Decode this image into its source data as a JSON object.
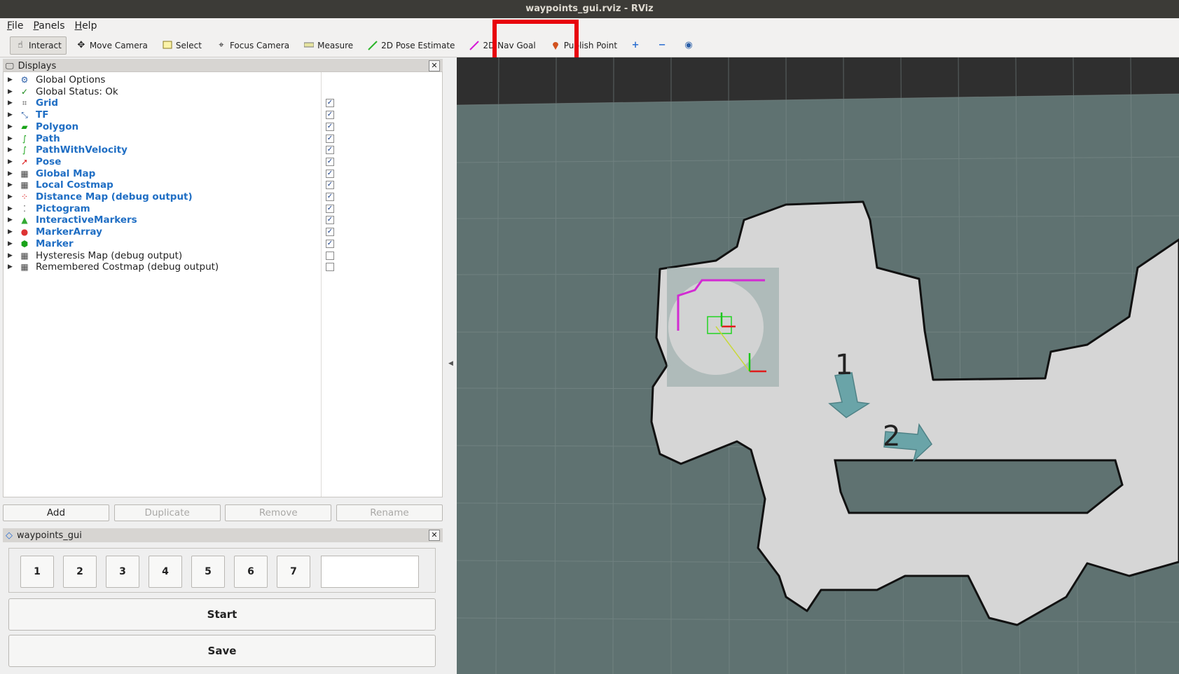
{
  "window": {
    "title": "waypoints_gui.rviz - RViz"
  },
  "menu": [
    "File",
    "Panels",
    "Help"
  ],
  "toolbar": {
    "tools": [
      {
        "label": "Interact",
        "icon": "hand-icon"
      },
      {
        "label": "Move Camera",
        "icon": "move-camera-icon"
      },
      {
        "label": "Select",
        "icon": "select-icon"
      },
      {
        "label": "Focus Camera",
        "icon": "focus-camera-icon"
      },
      {
        "label": "Measure",
        "icon": "ruler-icon"
      },
      {
        "label": "2D Pose Estimate",
        "icon": "pose-estimate-arrow-icon"
      },
      {
        "label": "2D Nav Goal",
        "icon": "nav-goal-arrow-icon"
      },
      {
        "label": "Publish Point",
        "icon": "map-pin-icon"
      }
    ],
    "extra_icons": [
      "add-tool-icon",
      "remove-tool-icon",
      "view-menu-icon"
    ],
    "active": "Interact",
    "highlighted": "Publish Point",
    "highlight_color": "#e8000b"
  },
  "displays": {
    "header": "Displays",
    "items": [
      {
        "label": "Global Options",
        "enabled": null,
        "style": "plain",
        "icon": "gear-icon"
      },
      {
        "label": "Global Status: Ok",
        "enabled": null,
        "style": "plain",
        "icon": "checkmark-icon"
      },
      {
        "label": "Grid",
        "enabled": true,
        "style": "blue",
        "icon": "grid-icon"
      },
      {
        "label": "TF",
        "enabled": true,
        "style": "blue",
        "icon": "axes-icon"
      },
      {
        "label": "Polygon",
        "enabled": true,
        "style": "blue",
        "icon": "polygon-icon"
      },
      {
        "label": "Path",
        "enabled": true,
        "style": "blue",
        "icon": "path-icon"
      },
      {
        "label": "PathWithVelocity",
        "enabled": true,
        "style": "blue",
        "icon": "path-icon"
      },
      {
        "label": "Pose",
        "enabled": true,
        "style": "blue",
        "icon": "pose-arrow-icon"
      },
      {
        "label": "Global Map",
        "enabled": true,
        "style": "blue",
        "icon": "map-grid-icon"
      },
      {
        "label": "Local Costmap",
        "enabled": true,
        "style": "blue",
        "icon": "map-grid-icon"
      },
      {
        "label": "Distance Map (debug output)",
        "enabled": true,
        "style": "blue",
        "icon": "red-dots-icon"
      },
      {
        "label": "Pictogram",
        "enabled": true,
        "style": "blue",
        "icon": "pictogram-icon"
      },
      {
        "label": "InteractiveMarkers",
        "enabled": true,
        "style": "blue",
        "icon": "interactive-markers-icon"
      },
      {
        "label": "MarkerArray",
        "enabled": true,
        "style": "blue",
        "icon": "marker-array-icon"
      },
      {
        "label": "Marker",
        "enabled": true,
        "style": "blue",
        "icon": "marker-cube-icon"
      },
      {
        "label": "Hysteresis Map (debug output)",
        "enabled": false,
        "style": "plain",
        "icon": "map-grid-icon"
      },
      {
        "label": "Remembered Costmap (debug output)",
        "enabled": false,
        "style": "plain",
        "icon": "map-grid-icon"
      }
    ],
    "buttons": [
      {
        "label": "Add",
        "enabled": true
      },
      {
        "label": "Duplicate",
        "enabled": false
      },
      {
        "label": "Remove",
        "enabled": false
      },
      {
        "label": "Rename",
        "enabled": false
      }
    ]
  },
  "waypoints_panel": {
    "header": "waypoints_gui",
    "numbers": [
      "1",
      "2",
      "3",
      "4",
      "5",
      "6",
      "7"
    ],
    "input_value": "",
    "start_label": "Start",
    "save_label": "Save"
  },
  "viewport": {
    "waypoint_labels": [
      "1",
      "2"
    ],
    "background_color": "#5f7271",
    "free_space_color": "#d6d6d6",
    "top_band_color": "#2f2f2f"
  }
}
